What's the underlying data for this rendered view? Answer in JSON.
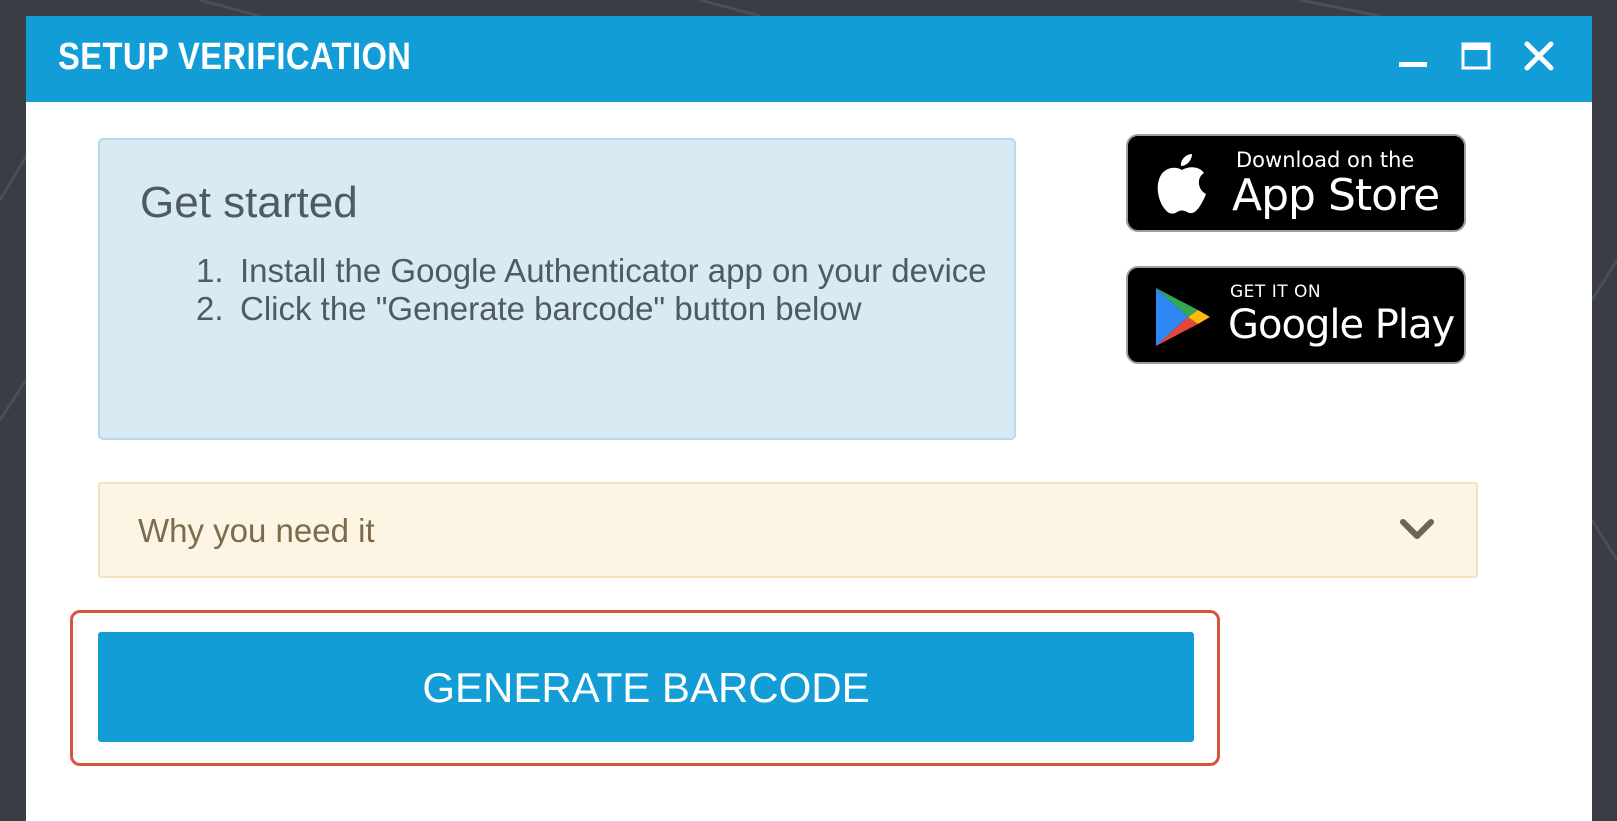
{
  "dialog": {
    "title": "SETUP VERIFICATION",
    "controls": {
      "minimize": "minimize-icon",
      "maximize": "maximize-icon",
      "close": "close-icon"
    }
  },
  "info": {
    "heading": "Get started",
    "steps": [
      {
        "num": "1.",
        "text": "Install the Google Authenticator app on your device"
      },
      {
        "num": "2.",
        "text": "Click the \"Generate barcode\" button below"
      }
    ]
  },
  "badges": {
    "app_store": {
      "small": "Download on the",
      "large": "App Store",
      "icon": "apple-icon"
    },
    "google_play": {
      "small": "GET IT ON",
      "large": "Google Play",
      "icon": "google-play-icon"
    }
  },
  "accordion": {
    "label": "Why you need it",
    "icon": "chevron-down-icon",
    "expanded": false
  },
  "primary_button": {
    "label": "GENERATE BARCODE"
  },
  "colors": {
    "accent": "#129dd7",
    "info_bg": "#d8ebf5",
    "warning_bg": "#fcf5e3",
    "highlight": "#d9543f",
    "backdrop": "#3a3d44"
  }
}
